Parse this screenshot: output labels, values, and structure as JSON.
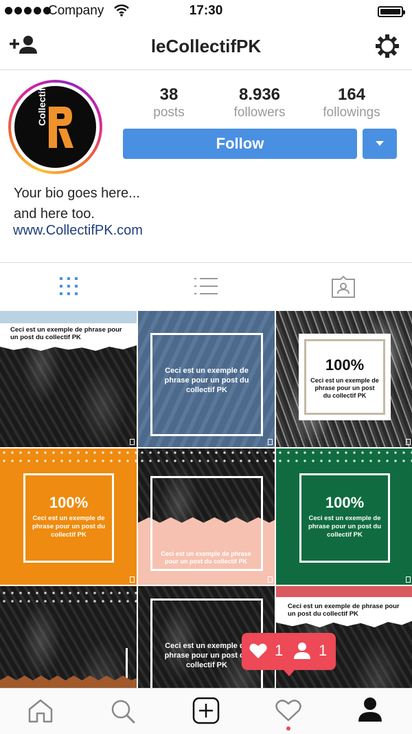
{
  "status_bar": {
    "carrier": "Company",
    "time": "17:30"
  },
  "nav": {
    "username": "leCollectifPK"
  },
  "profile": {
    "avatar_text": "Collectif.",
    "stats": [
      {
        "value": "38",
        "label": "posts"
      },
      {
        "value": "8.936",
        "label": "followers"
      },
      {
        "value": "164",
        "label": "followings"
      }
    ],
    "follow_label": "Follow",
    "bio_line1": "Your bio goes here...",
    "bio_line2": "and here too.",
    "website": "www.CollectifPK.com"
  },
  "posts": [
    {
      "text": "Ceci est un exemple de phrase pour un post du collectif PK"
    },
    {
      "text": "Ceci est un exemple de phrase pour un post du collectif PK"
    },
    {
      "headline": "100%",
      "text": "Ceci est un exemple de phrase pour un post du collectif PK"
    },
    {
      "headline": "100%",
      "text": "Ceci est un exemple de phrase pour un post du collectif PK"
    },
    {
      "text": "Ceci est un exemple de phrase pour un post du collectif PK"
    },
    {
      "headline": "100%",
      "text": "Ceci est un exemple de phrase pour un post du collectif PK"
    },
    {
      "text": ""
    },
    {
      "text": "Ceci est un exemple de phrase pour un post du collectif PK"
    },
    {
      "text": "Ceci est un exemple de phrase pour un post du collectif PK"
    }
  ],
  "notification": {
    "likes": "1",
    "follows": "1"
  },
  "colors": {
    "accent": "#4a90e2",
    "notification": "#ed4956",
    "link": "#1d3f7a"
  }
}
